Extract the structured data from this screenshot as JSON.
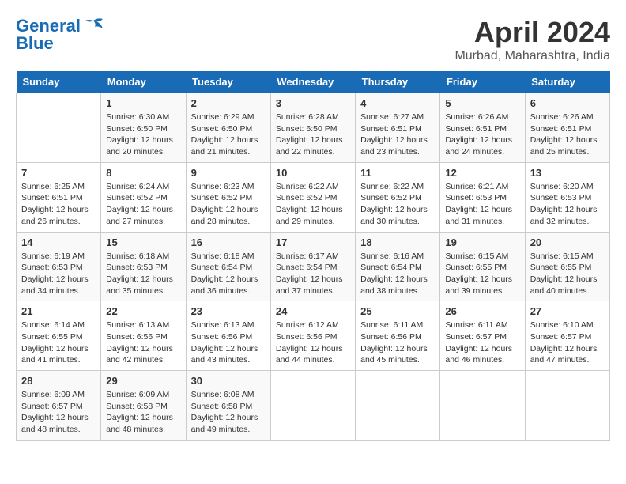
{
  "logo": {
    "line1": "General",
    "line2": "Blue"
  },
  "title": "April 2024",
  "location": "Murbad, Maharashtra, India",
  "days_header": [
    "Sunday",
    "Monday",
    "Tuesday",
    "Wednesday",
    "Thursday",
    "Friday",
    "Saturday"
  ],
  "weeks": [
    [
      {
        "day": "",
        "info": ""
      },
      {
        "day": "1",
        "info": "Sunrise: 6:30 AM\nSunset: 6:50 PM\nDaylight: 12 hours\nand 20 minutes."
      },
      {
        "day": "2",
        "info": "Sunrise: 6:29 AM\nSunset: 6:50 PM\nDaylight: 12 hours\nand 21 minutes."
      },
      {
        "day": "3",
        "info": "Sunrise: 6:28 AM\nSunset: 6:50 PM\nDaylight: 12 hours\nand 22 minutes."
      },
      {
        "day": "4",
        "info": "Sunrise: 6:27 AM\nSunset: 6:51 PM\nDaylight: 12 hours\nand 23 minutes."
      },
      {
        "day": "5",
        "info": "Sunrise: 6:26 AM\nSunset: 6:51 PM\nDaylight: 12 hours\nand 24 minutes."
      },
      {
        "day": "6",
        "info": "Sunrise: 6:26 AM\nSunset: 6:51 PM\nDaylight: 12 hours\nand 25 minutes."
      }
    ],
    [
      {
        "day": "7",
        "info": "Sunrise: 6:25 AM\nSunset: 6:51 PM\nDaylight: 12 hours\nand 26 minutes."
      },
      {
        "day": "8",
        "info": "Sunrise: 6:24 AM\nSunset: 6:52 PM\nDaylight: 12 hours\nand 27 minutes."
      },
      {
        "day": "9",
        "info": "Sunrise: 6:23 AM\nSunset: 6:52 PM\nDaylight: 12 hours\nand 28 minutes."
      },
      {
        "day": "10",
        "info": "Sunrise: 6:22 AM\nSunset: 6:52 PM\nDaylight: 12 hours\nand 29 minutes."
      },
      {
        "day": "11",
        "info": "Sunrise: 6:22 AM\nSunset: 6:52 PM\nDaylight: 12 hours\nand 30 minutes."
      },
      {
        "day": "12",
        "info": "Sunrise: 6:21 AM\nSunset: 6:53 PM\nDaylight: 12 hours\nand 31 minutes."
      },
      {
        "day": "13",
        "info": "Sunrise: 6:20 AM\nSunset: 6:53 PM\nDaylight: 12 hours\nand 32 minutes."
      }
    ],
    [
      {
        "day": "14",
        "info": "Sunrise: 6:19 AM\nSunset: 6:53 PM\nDaylight: 12 hours\nand 34 minutes."
      },
      {
        "day": "15",
        "info": "Sunrise: 6:18 AM\nSunset: 6:53 PM\nDaylight: 12 hours\nand 35 minutes."
      },
      {
        "day": "16",
        "info": "Sunrise: 6:18 AM\nSunset: 6:54 PM\nDaylight: 12 hours\nand 36 minutes."
      },
      {
        "day": "17",
        "info": "Sunrise: 6:17 AM\nSunset: 6:54 PM\nDaylight: 12 hours\nand 37 minutes."
      },
      {
        "day": "18",
        "info": "Sunrise: 6:16 AM\nSunset: 6:54 PM\nDaylight: 12 hours\nand 38 minutes."
      },
      {
        "day": "19",
        "info": "Sunrise: 6:15 AM\nSunset: 6:55 PM\nDaylight: 12 hours\nand 39 minutes."
      },
      {
        "day": "20",
        "info": "Sunrise: 6:15 AM\nSunset: 6:55 PM\nDaylight: 12 hours\nand 40 minutes."
      }
    ],
    [
      {
        "day": "21",
        "info": "Sunrise: 6:14 AM\nSunset: 6:55 PM\nDaylight: 12 hours\nand 41 minutes."
      },
      {
        "day": "22",
        "info": "Sunrise: 6:13 AM\nSunset: 6:56 PM\nDaylight: 12 hours\nand 42 minutes."
      },
      {
        "day": "23",
        "info": "Sunrise: 6:13 AM\nSunset: 6:56 PM\nDaylight: 12 hours\nand 43 minutes."
      },
      {
        "day": "24",
        "info": "Sunrise: 6:12 AM\nSunset: 6:56 PM\nDaylight: 12 hours\nand 44 minutes."
      },
      {
        "day": "25",
        "info": "Sunrise: 6:11 AM\nSunset: 6:56 PM\nDaylight: 12 hours\nand 45 minutes."
      },
      {
        "day": "26",
        "info": "Sunrise: 6:11 AM\nSunset: 6:57 PM\nDaylight: 12 hours\nand 46 minutes."
      },
      {
        "day": "27",
        "info": "Sunrise: 6:10 AM\nSunset: 6:57 PM\nDaylight: 12 hours\nand 47 minutes."
      }
    ],
    [
      {
        "day": "28",
        "info": "Sunrise: 6:09 AM\nSunset: 6:57 PM\nDaylight: 12 hours\nand 48 minutes."
      },
      {
        "day": "29",
        "info": "Sunrise: 6:09 AM\nSunset: 6:58 PM\nDaylight: 12 hours\nand 48 minutes."
      },
      {
        "day": "30",
        "info": "Sunrise: 6:08 AM\nSunset: 6:58 PM\nDaylight: 12 hours\nand 49 minutes."
      },
      {
        "day": "",
        "info": ""
      },
      {
        "day": "",
        "info": ""
      },
      {
        "day": "",
        "info": ""
      },
      {
        "day": "",
        "info": ""
      }
    ]
  ]
}
